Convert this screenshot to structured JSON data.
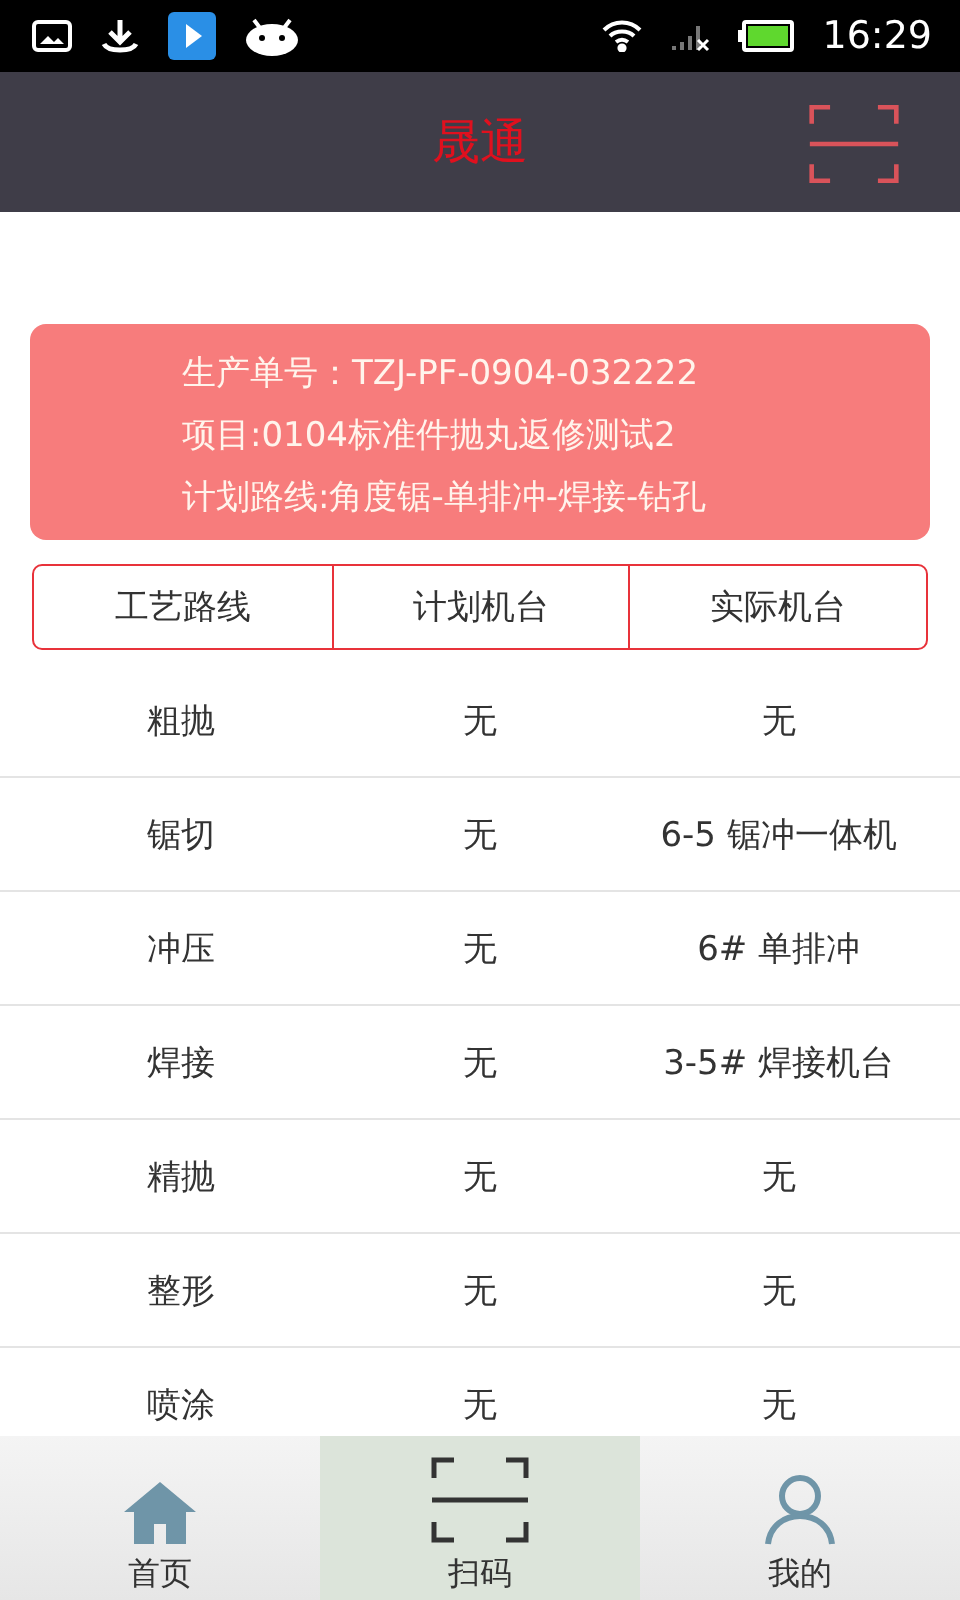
{
  "status_bar": {
    "time": "16:29"
  },
  "header": {
    "title": "晟通"
  },
  "order_card": {
    "lines": [
      "生产单号：TZJ-PF-0904-032222",
      "项目:0104标准件抛丸返修测试2",
      "计划路线:角度锯-单排冲-焊接-钻孔"
    ]
  },
  "table": {
    "columns": [
      "工艺路线",
      "计划机台",
      "实际机台"
    ],
    "rows": [
      [
        "粗抛",
        "无",
        "无"
      ],
      [
        "锯切",
        "无",
        "6-5 锯冲一体机"
      ],
      [
        "冲压",
        "无",
        "6# 单排冲"
      ],
      [
        "焊接",
        "无",
        "3-5# 焊接机台"
      ],
      [
        "精抛",
        "无",
        "无"
      ],
      [
        "整形",
        "无",
        "无"
      ],
      [
        "喷涂",
        "无",
        "无"
      ]
    ]
  },
  "tab_bar": [
    {
      "kind": "home",
      "label": "首页",
      "selected": false
    },
    {
      "kind": "scan",
      "label": "扫码",
      "selected": true
    },
    {
      "kind": "profile",
      "label": "我的",
      "selected": false
    }
  ]
}
